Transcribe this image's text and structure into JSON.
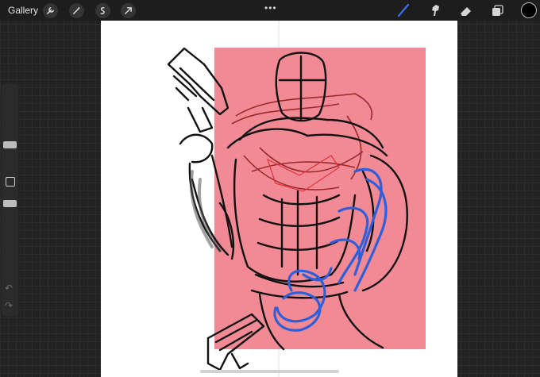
{
  "topbar": {
    "gallery_label": "Gallery",
    "left_tools": [
      "wrench-icon",
      "magic-wand-icon",
      "selection-icon",
      "transform-arrow-icon"
    ],
    "more_label": "•••",
    "right_tools": [
      "brush-icon",
      "smudge-icon",
      "eraser-icon",
      "layers-icon"
    ],
    "active_tool": "brush-icon",
    "accent_color": "#3b6df0",
    "current_color": "#000000"
  },
  "sidebar": {
    "controls": [
      "brush-size-slider",
      "modify-button",
      "opacity-slider",
      "undo-arrow-icon",
      "redo-arrow-icon"
    ],
    "undo_label": "↶",
    "redo_label": "↷"
  },
  "artwork": {
    "background_color": "#f28a96",
    "stroke_colors": [
      "#111111",
      "#8a1a1a",
      "#2f5fd8"
    ]
  }
}
